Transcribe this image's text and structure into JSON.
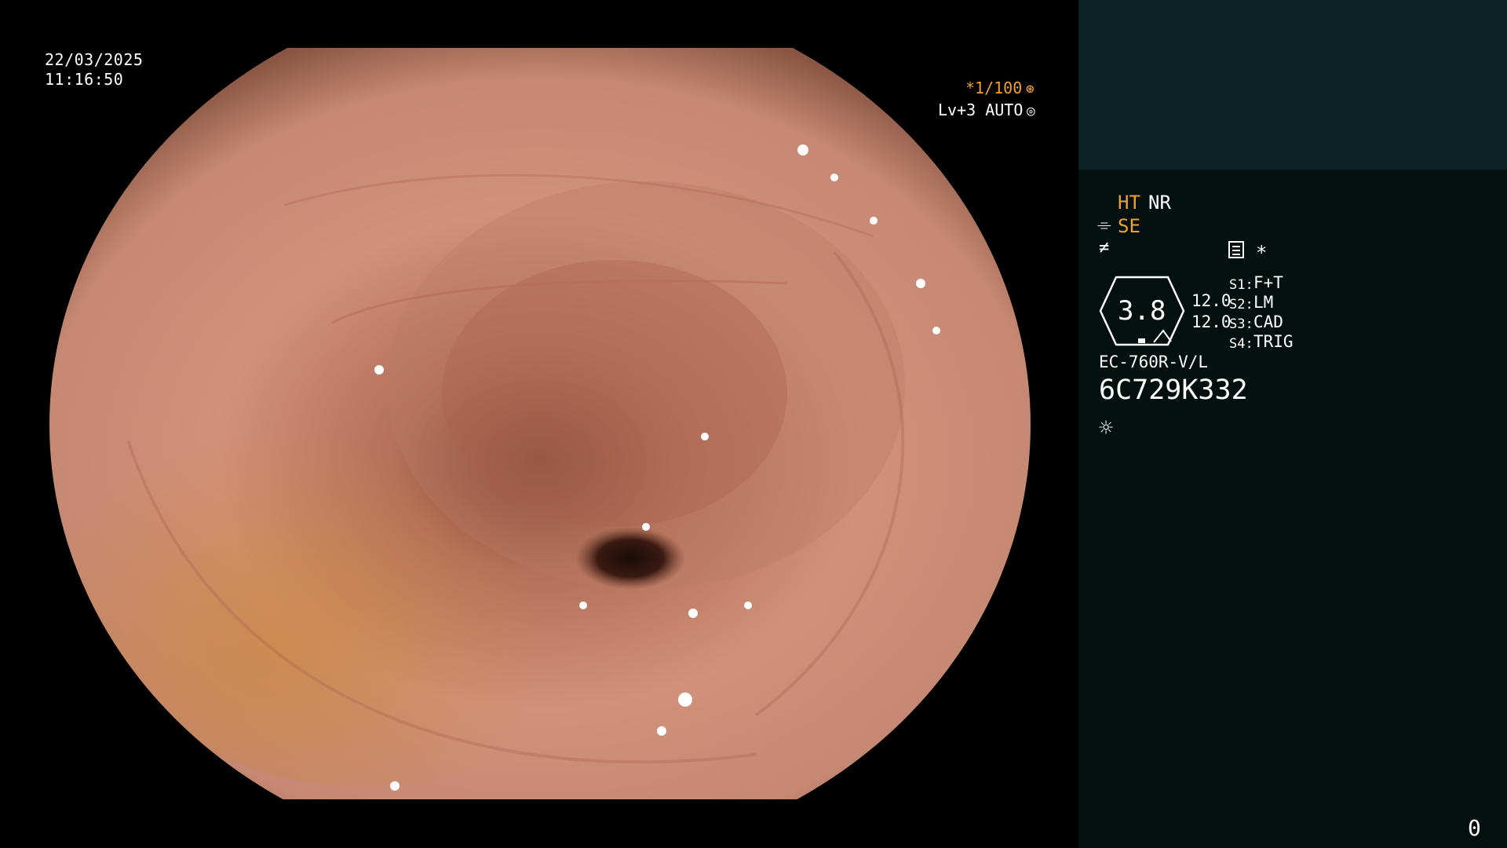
{
  "overlay": {
    "date": "22/03/2025",
    "time": "11:16:50",
    "shutter": "*1/100",
    "shutter_icon": "aperture-icon",
    "level": "Lv+3 AUTO",
    "level_icon": "iris-icon"
  },
  "panel": {
    "ht": "HT",
    "nr": "NR",
    "se": "SE",
    "f_icon": "structure-enhancement-icon",
    "tube_icon": "scope-icon",
    "menu_icon": "settings-list-icon",
    "asterisk": "*",
    "zoom_value": "3.8",
    "value_a": "12.0",
    "value_b": "12.0",
    "switches": [
      {
        "key": "S1:",
        "value": "F+T"
      },
      {
        "key": "S2:",
        "value": "LM"
      },
      {
        "key": "S3:",
        "value": "CAD"
      },
      {
        "key": "S4:",
        "value": "TRIG"
      }
    ],
    "model": "EC-760R-V/L",
    "serial": "6C729K332",
    "light_icon": "light-source-icon",
    "counter": "0"
  },
  "colors": {
    "panel_bg": "#041010",
    "panel_top": "#0d2222",
    "accent": "#f0a030",
    "tissue": "#c98a6c"
  }
}
